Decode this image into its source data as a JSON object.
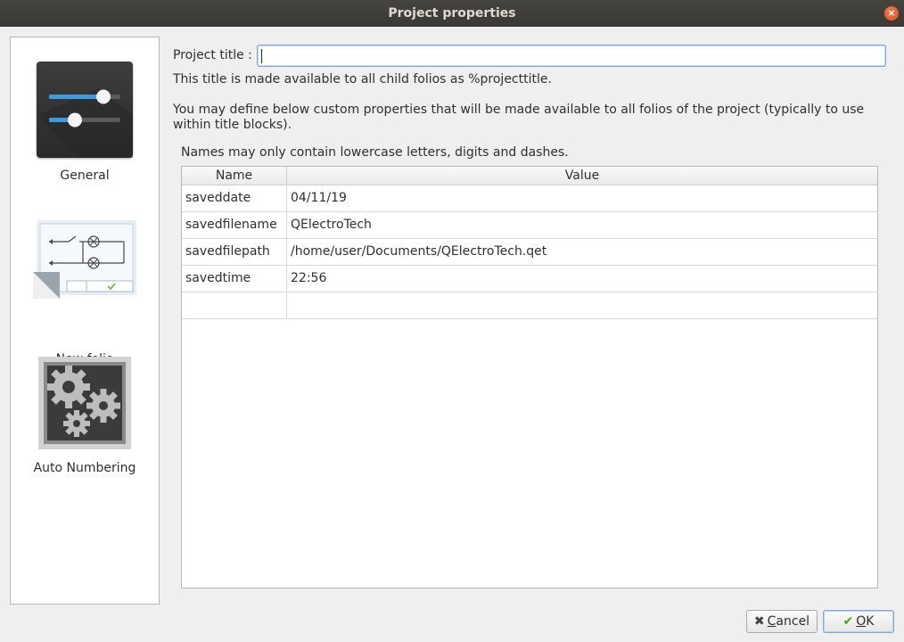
{
  "window": {
    "title": "Project properties",
    "close_glyph": "×"
  },
  "sidebar": {
    "items": [
      {
        "label": "General",
        "icon": "sliders-icon"
      },
      {
        "label": "New folio",
        "icon": "folio-schematic-icon"
      },
      {
        "label": "Auto Numbering",
        "icon": "gears-icon"
      }
    ]
  },
  "form": {
    "project_title_label": "Project title :",
    "project_title_value": "",
    "info_child_folios": "This title is made available to all child folios as %projecttitle.",
    "info_custom_properties": "You may define below custom properties that will be made available to all folios of the project (typically to use within title blocks).",
    "info_names": "Names may only contain lowercase letters, digits and dashes."
  },
  "table": {
    "headers": {
      "name": "Name",
      "value": "Value"
    },
    "rows": [
      {
        "name": "saveddate",
        "value": "04/11/19"
      },
      {
        "name": "savedfilename",
        "value": "QElectroTech"
      },
      {
        "name": "savedfilepath",
        "value": "/home/user/Documents/QElectroTech.qet"
      },
      {
        "name": "savedtime",
        "value": "22:56"
      },
      {
        "name": "",
        "value": ""
      }
    ]
  },
  "buttons": {
    "cancel_first": "C",
    "cancel_rest": "ancel",
    "ok_first": "O",
    "ok_rest": "K",
    "cancel_glyph": "✖",
    "ok_glyph": "✔"
  },
  "colors": {
    "accent_blue": "#4a90d9",
    "titlebar": "#3c3b37",
    "close_orange": "#e95420"
  }
}
